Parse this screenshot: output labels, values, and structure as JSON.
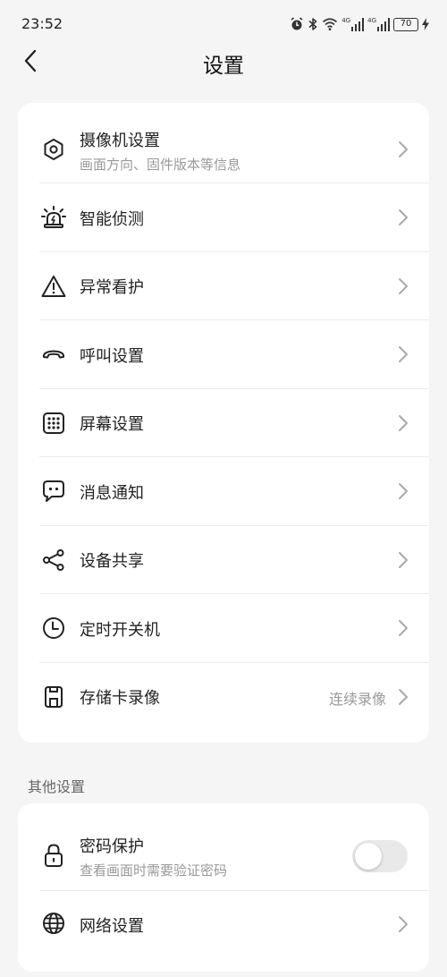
{
  "status": {
    "time": "23:52",
    "battery": "70",
    "sig1_label": "4G",
    "sig2_label": "4G",
    "icons": [
      "alarm-icon",
      "bluetooth-icon",
      "wifi-icon",
      "signal-icon",
      "signal-icon",
      "battery-icon",
      "charging-icon"
    ]
  },
  "header": {
    "title": "设置",
    "back_icon": "chevron-left-icon"
  },
  "main": {
    "items": [
      {
        "label": "摄像机设置",
        "sub": "画面方向、固件版本等信息",
        "icon": "hexagon-gear-icon"
      },
      {
        "label": "智能侦测",
        "icon": "alarm-light-icon"
      },
      {
        "label": "异常看护",
        "icon": "warning-icon"
      },
      {
        "label": "呼叫设置",
        "icon": "phone-hangup-icon"
      },
      {
        "label": "屏幕设置",
        "icon": "keypad-grid-icon"
      },
      {
        "label": "消息通知",
        "icon": "chat-bubble-icon"
      },
      {
        "label": "设备共享",
        "icon": "share-icon"
      },
      {
        "label": "定时开关机",
        "icon": "clock-icon"
      },
      {
        "label": "存储卡录像",
        "value": "连续录像",
        "icon": "sd-card-icon"
      }
    ]
  },
  "other": {
    "section_title": "其他设置",
    "password": {
      "label": "密码保护",
      "sub": "查看画面时需要验证密码",
      "enabled": false,
      "icon": "lock-icon"
    },
    "network": {
      "label": "网络设置",
      "icon": "globe-icon"
    }
  }
}
